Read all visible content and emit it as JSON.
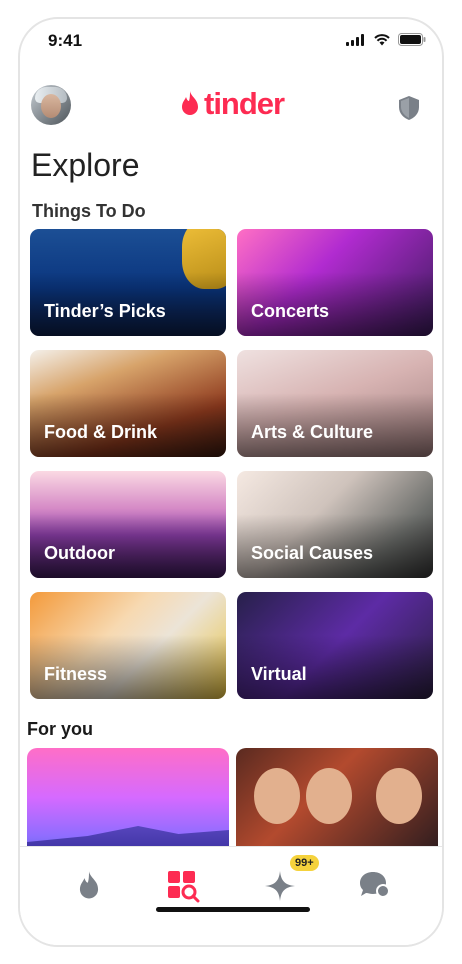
{
  "status_bar": {
    "time": "9:41"
  },
  "header": {
    "logo_text": "tinder"
  },
  "page_title": "Explore",
  "sections": {
    "things_to_do": "Things To Do",
    "for_you": "For you"
  },
  "categories": [
    {
      "label": "Tinder’s Picks"
    },
    {
      "label": "Concerts"
    },
    {
      "label": "Food & Drink"
    },
    {
      "label": "Arts & Culture"
    },
    {
      "label": "Outdoor"
    },
    {
      "label": "Social Causes"
    },
    {
      "label": "Fitness"
    },
    {
      "label": "Virtual"
    }
  ],
  "tab_bar": {
    "badge": "99+"
  },
  "colors": {
    "brand": "#fd2b52",
    "badge": "#f5d23c",
    "tab_inactive": "#7a8088"
  }
}
